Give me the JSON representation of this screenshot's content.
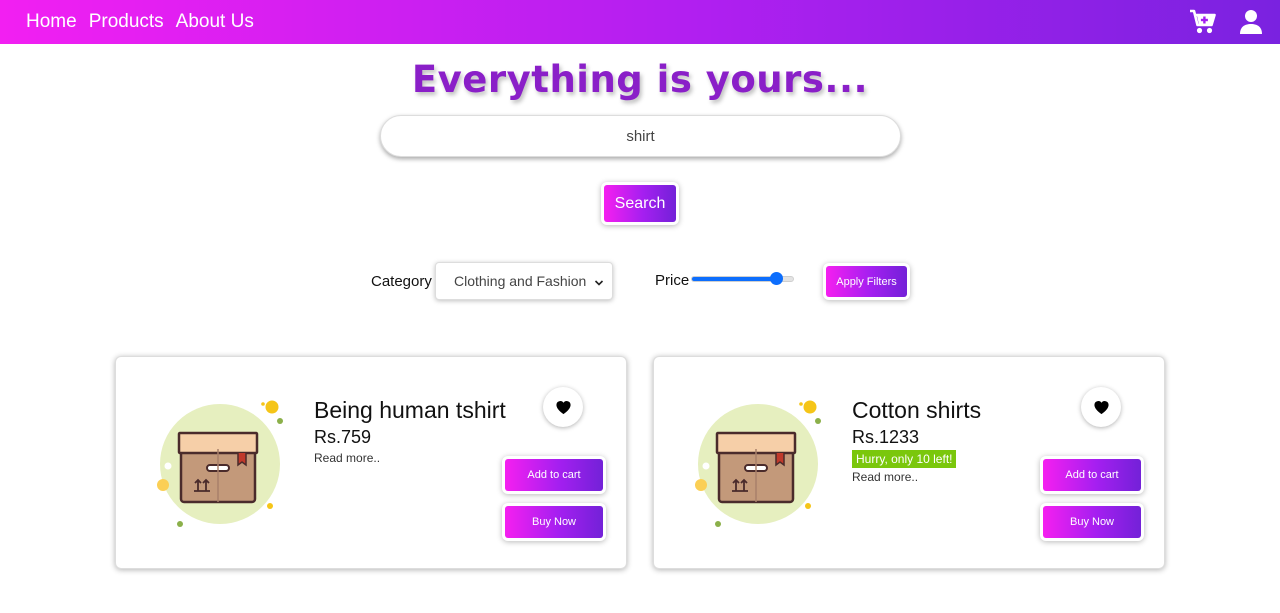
{
  "nav": {
    "links": [
      "Home",
      "Products",
      "About Us"
    ],
    "icons": [
      "cart-plus-icon",
      "user-icon"
    ]
  },
  "hero": {
    "title": "Everything is yours..."
  },
  "search": {
    "value": "shirt",
    "button_label": "Search"
  },
  "filters": {
    "category_label": "Category",
    "category_selected": "Clothing and Fashion",
    "price_label": "Price",
    "price_slider_fraction": 0.83,
    "apply_label": "Apply Filters"
  },
  "products": [
    {
      "name": "Being human tshirt",
      "price": "Rs.759",
      "badge": "",
      "read_more": "Read more..",
      "add_to_cart": "Add to cart",
      "buy_now": "Buy Now"
    },
    {
      "name": "Cotton shirts",
      "price": "Rs.1233",
      "badge": "Hurry, only 10 left!",
      "read_more": "Read more..",
      "add_to_cart": "Add to cart",
      "buy_now": "Buy Now"
    }
  ],
  "colors": {
    "brand_gradient_start": "#f21ff2",
    "brand_gradient_end": "#7a22e0",
    "title": "#8a1fc8",
    "slider": "#0d6efd",
    "stock_badge": "#7ac70c"
  }
}
